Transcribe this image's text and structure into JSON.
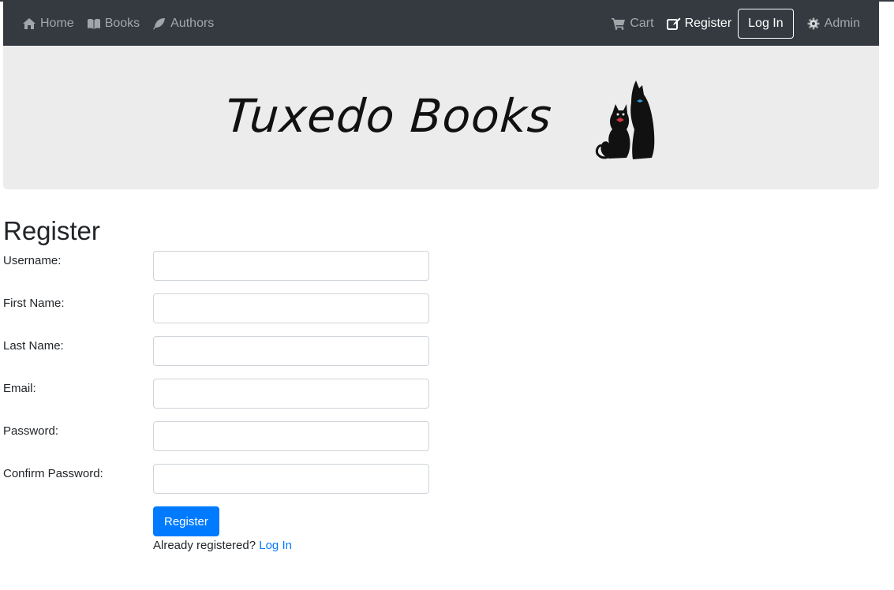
{
  "nav": {
    "left": [
      {
        "label": "Home",
        "icon": "home-icon"
      },
      {
        "label": "Books",
        "icon": "book-icon"
      },
      {
        "label": "Authors",
        "icon": "feather-icon"
      }
    ],
    "cart_label": "Cart",
    "register_label": "Register",
    "login_label": "Log In",
    "admin_label": "Admin"
  },
  "banner": {
    "logo_text": "Tuxedo Books"
  },
  "page": {
    "title": "Register"
  },
  "form": {
    "fields": [
      {
        "label": "Username:",
        "value": ""
      },
      {
        "label": "First Name:",
        "value": ""
      },
      {
        "label": "Last Name:",
        "value": ""
      },
      {
        "label": "Email:",
        "value": ""
      },
      {
        "label": "Password:",
        "value": ""
      },
      {
        "label": "Confirm Password:",
        "value": ""
      }
    ],
    "submit_label": "Register",
    "already_text": "Already registered?",
    "login_link": "Log In"
  },
  "colors": {
    "navbar": "#343a40",
    "banner": "#ececec",
    "primary": "#007bff"
  }
}
